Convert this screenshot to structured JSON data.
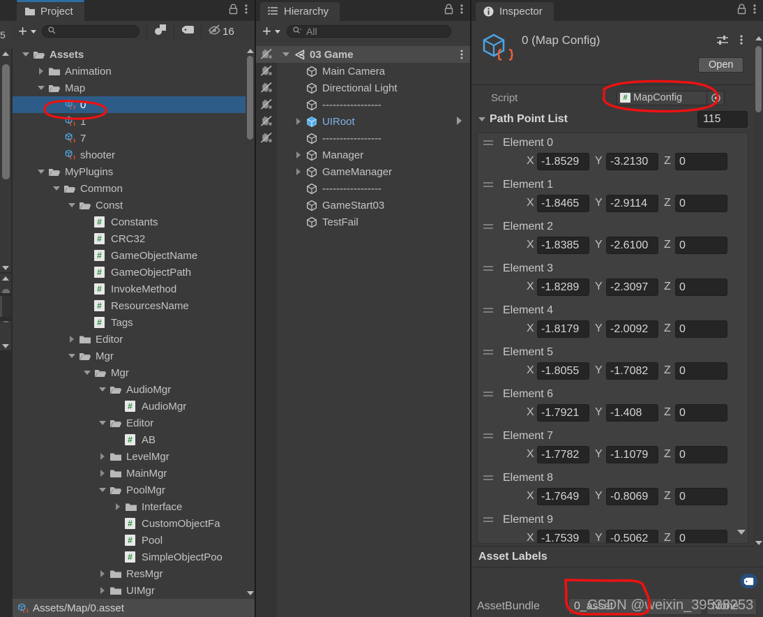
{
  "window": {
    "background": "#1b1b1b",
    "accent": "#2f6ea5",
    "selection_blue": "#2d5c88",
    "annotation_color": "#ee1111"
  },
  "project_panel": {
    "tab_label": "Project",
    "tab_icon": "folder-icon",
    "toolbar": {
      "create_label": "+",
      "search_placeholder": "",
      "filter_type_icon": "filter-by-type-icon",
      "filter_label_icon": "filter-by-label-icon",
      "hidden_icon": "hidden-eye-icon",
      "hidden_count": "16"
    },
    "tree": [
      {
        "label": "Assets",
        "depth": 0,
        "twisty": "down",
        "icon": "folder-open-icon",
        "bold": true
      },
      {
        "label": "Animation",
        "depth": 1,
        "twisty": "right",
        "icon": "folder-icon"
      },
      {
        "label": "Map",
        "depth": 1,
        "twisty": "down",
        "icon": "folder-open-icon"
      },
      {
        "label": "0",
        "depth": 2,
        "twisty": "none",
        "icon": "scriptable-object-icon",
        "selected": true
      },
      {
        "label": "1",
        "depth": 2,
        "twisty": "none",
        "icon": "scriptable-object-icon"
      },
      {
        "label": "7",
        "depth": 2,
        "twisty": "none",
        "icon": "scriptable-object-icon"
      },
      {
        "label": "shooter",
        "depth": 2,
        "twisty": "none",
        "icon": "scriptable-object-icon"
      },
      {
        "label": "MyPlugins",
        "depth": 1,
        "twisty": "down",
        "icon": "folder-open-icon"
      },
      {
        "label": "Common",
        "depth": 2,
        "twisty": "down",
        "icon": "folder-open-icon"
      },
      {
        "label": "Const",
        "depth": 3,
        "twisty": "down",
        "icon": "folder-open-icon"
      },
      {
        "label": "Constants",
        "depth": 4,
        "twisty": "none",
        "icon": "csharp-script-icon"
      },
      {
        "label": "CRC32",
        "depth": 4,
        "twisty": "none",
        "icon": "csharp-script-icon"
      },
      {
        "label": "GameObjectName",
        "depth": 4,
        "twisty": "none",
        "icon": "csharp-script-icon"
      },
      {
        "label": "GameObjectPath",
        "depth": 4,
        "twisty": "none",
        "icon": "csharp-script-icon"
      },
      {
        "label": "InvokeMethod",
        "depth": 4,
        "twisty": "none",
        "icon": "csharp-script-icon"
      },
      {
        "label": "ResourcesName",
        "depth": 4,
        "twisty": "none",
        "icon": "csharp-script-icon"
      },
      {
        "label": "Tags",
        "depth": 4,
        "twisty": "none",
        "icon": "csharp-script-icon"
      },
      {
        "label": "Editor",
        "depth": 3,
        "twisty": "right",
        "icon": "folder-icon"
      },
      {
        "label": "Mgr",
        "depth": 3,
        "twisty": "down",
        "icon": "folder-open-icon"
      },
      {
        "label": "Mgr",
        "depth": 4,
        "twisty": "down",
        "icon": "folder-open-icon"
      },
      {
        "label": "AudioMgr",
        "depth": 5,
        "twisty": "down",
        "icon": "folder-open-icon"
      },
      {
        "label": "AudioMgr",
        "depth": 6,
        "twisty": "none",
        "icon": "csharp-script-icon"
      },
      {
        "label": "Editor",
        "depth": 5,
        "twisty": "down",
        "icon": "folder-open-icon"
      },
      {
        "label": "AB",
        "depth": 6,
        "twisty": "none",
        "icon": "csharp-script-icon"
      },
      {
        "label": "LevelMgr",
        "depth": 5,
        "twisty": "right",
        "icon": "folder-icon"
      },
      {
        "label": "MainMgr",
        "depth": 5,
        "twisty": "right",
        "icon": "folder-icon"
      },
      {
        "label": "PoolMgr",
        "depth": 5,
        "twisty": "down",
        "icon": "folder-open-icon"
      },
      {
        "label": "Interface",
        "depth": 6,
        "twisty": "right",
        "icon": "folder-icon"
      },
      {
        "label": "CustomObjectFa",
        "depth": 6,
        "twisty": "none",
        "icon": "csharp-script-icon"
      },
      {
        "label": "Pool",
        "depth": 6,
        "twisty": "none",
        "icon": "csharp-script-icon"
      },
      {
        "label": "SimpleObjectPoo",
        "depth": 6,
        "twisty": "none",
        "icon": "csharp-script-icon"
      },
      {
        "label": "ResMgr",
        "depth": 5,
        "twisty": "right",
        "icon": "folder-icon"
      },
      {
        "label": "UIMgr",
        "depth": 5,
        "twisty": "right",
        "icon": "folder-icon"
      }
    ],
    "status_bar": {
      "path": "Assets/Map/0.asset",
      "icon": "scriptable-object-icon"
    }
  },
  "hierarchy_panel": {
    "tab_label": "Hierarchy",
    "tab_icon": "hierarchy-list-icon",
    "toolbar": {
      "create_label": "+",
      "search_placeholder": "All"
    },
    "tree": [
      {
        "label": "03 Game",
        "depth": 0,
        "twisty": "down",
        "icon": "scene-icon",
        "bold": true,
        "selected": true,
        "kebab": true,
        "vis": true
      },
      {
        "label": "Main Camera",
        "depth": 1,
        "twisty": "none",
        "icon": "gameobject-icon",
        "vis": true
      },
      {
        "label": "Directional Light",
        "depth": 1,
        "twisty": "none",
        "icon": "gameobject-icon",
        "vis": true
      },
      {
        "label": "-----------------",
        "depth": 1,
        "twisty": "none",
        "icon": "gameobject-icon",
        "vis": true
      },
      {
        "label": "UIRoot",
        "depth": 1,
        "twisty": "right",
        "icon": "prefab-icon",
        "blue": true,
        "vis": true,
        "chevron": true
      },
      {
        "label": "-----------------",
        "depth": 1,
        "twisty": "none",
        "icon": "gameobject-icon",
        "vis": true
      },
      {
        "label": "Manager",
        "depth": 1,
        "twisty": "right",
        "icon": "gameobject-icon"
      },
      {
        "label": "GameManager",
        "depth": 1,
        "twisty": "right",
        "icon": "gameobject-icon"
      },
      {
        "label": "-----------------",
        "depth": 1,
        "twisty": "none",
        "icon": "gameobject-icon"
      },
      {
        "label": "GameStart03",
        "depth": 1,
        "twisty": "none",
        "icon": "gameobject-icon"
      },
      {
        "label": "TestFail",
        "depth": 1,
        "twisty": "none",
        "icon": "gameobject-icon"
      }
    ]
  },
  "inspector_panel": {
    "tab_label": "Inspector",
    "tab_icon": "info-icon",
    "asset_title": "0 (Map Config)",
    "asset_icon": "scriptable-object-icon",
    "open_button": "Open",
    "preset_icon": "preset-icon",
    "kebab_icon": "kebab-icon",
    "script_row": {
      "label": "Script",
      "value": "MapConfig",
      "value_icon": "csharp-script-icon",
      "picker_icon": "object-picker-icon"
    },
    "list_header": {
      "label": "Path Point List",
      "size": "115",
      "twisty": "down"
    },
    "axis_labels": {
      "x": "X",
      "y": "Y",
      "z": "Z"
    },
    "elements": [
      {
        "name": "Element 0",
        "x": "-1.8529",
        "y": "-3.2130",
        "z": "0"
      },
      {
        "name": "Element 1",
        "x": "-1.8465",
        "y": "-2.9114",
        "z": "0"
      },
      {
        "name": "Element 2",
        "x": "-1.8385",
        "y": "-2.6100",
        "z": "0"
      },
      {
        "name": "Element 3",
        "x": "-1.8289",
        "y": "-2.3097",
        "z": "0"
      },
      {
        "name": "Element 4",
        "x": "-1.8179",
        "y": "-2.0092",
        "z": "0"
      },
      {
        "name": "Element 5",
        "x": "-1.8055",
        "y": "-1.7082",
        "z": "0"
      },
      {
        "name": "Element 6",
        "x": "-1.7921",
        "y": "-1.408",
        "z": "0"
      },
      {
        "name": "Element 7",
        "x": "-1.7782",
        "y": "-1.1079",
        "z": "0"
      },
      {
        "name": "Element 8",
        "x": "-1.7649",
        "y": "-0.8069",
        "z": "0"
      },
      {
        "name": "Element 9",
        "x": "-1.7539",
        "y": "-0.5062",
        "z": "0"
      }
    ],
    "asset_labels": {
      "header": "Asset Labels",
      "tag_icon": "label-tag-icon",
      "assetbundle_label": "AssetBundle",
      "assetbundle_value": "0_asset",
      "variant_value": "None"
    }
  },
  "watermark": {
    "text": "CSDN @weixin_39538253"
  }
}
